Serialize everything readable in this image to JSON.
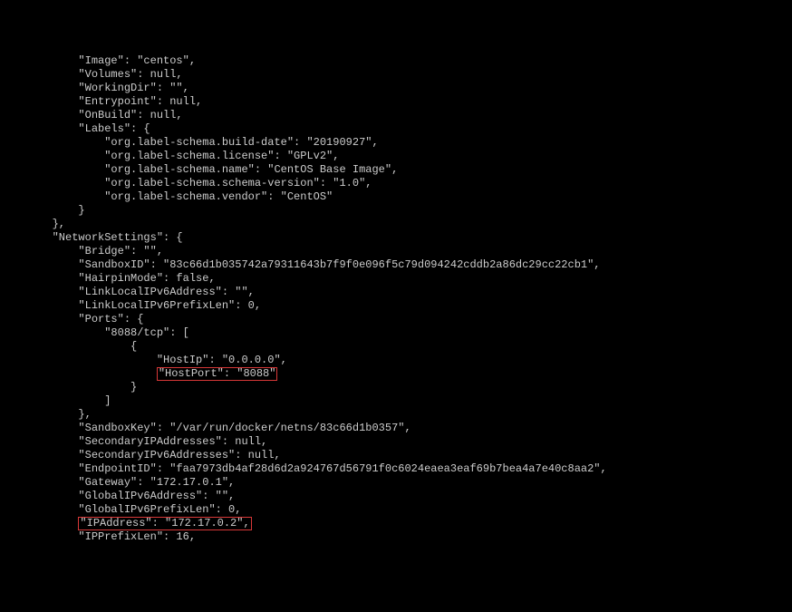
{
  "lines": [
    "        \"Image\": \"centos\",",
    "        \"Volumes\": null,",
    "        \"WorkingDir\": \"\",",
    "        \"Entrypoint\": null,",
    "        \"OnBuild\": null,",
    "        \"Labels\": {",
    "            \"org.label-schema.build-date\": \"20190927\",",
    "            \"org.label-schema.license\": \"GPLv2\",",
    "            \"org.label-schema.name\": \"CentOS Base Image\",",
    "            \"org.label-schema.schema-version\": \"1.0\",",
    "            \"org.label-schema.vendor\": \"CentOS\"",
    "        }",
    "    },",
    "    \"NetworkSettings\": {",
    "        \"Bridge\": \"\",",
    "        \"SandboxID\": \"83c66d1b035742a79311643b7f9f0e096f5c79d094242cddb2a86dc29cc22cb1\",",
    "        \"HairpinMode\": false,",
    "        \"LinkLocalIPv6Address\": \"\",",
    "        \"LinkLocalIPv6PrefixLen\": 0,",
    "        \"Ports\": {",
    "            \"8088/tcp\": [",
    "                {",
    "                    \"HostIp\": \"0.0.0.0\",",
    "",
    "                }",
    "            ]",
    "        },",
    "        \"SandboxKey\": \"/var/run/docker/netns/83c66d1b0357\",",
    "        \"SecondaryIPAddresses\": null,",
    "        \"SecondaryIPv6Addresses\": null,",
    "        \"EndpointID\": \"faa7973db4af28d6d2a924767d56791f0c6024eaea3eaf69b7bea4a7e40c8aa2\",",
    "        \"Gateway\": \"172.17.0.1\",",
    "        \"GlobalIPv6Address\": \"\",",
    "        \"GlobalIPv6PrefixLen\": 0,",
    "",
    "        \"IPPrefixLen\": 16,"
  ],
  "highlight1_prefix": "                    ",
  "highlight1_content": "\"HostPort\": \"8088\"",
  "highlight2_prefix": "        ",
  "highlight2_content": "\"IPAddress\": \"172.17.0.2\",",
  "highlight1_line_index": 23,
  "highlight2_line_index": 34,
  "left_pad": "    "
}
